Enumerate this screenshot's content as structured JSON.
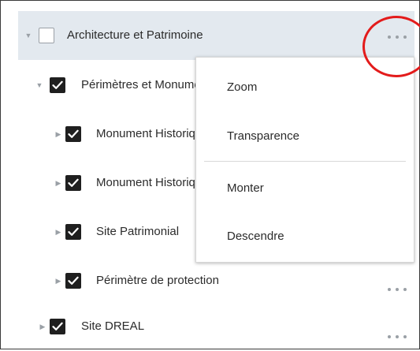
{
  "tree": {
    "root": {
      "label": "Architecture et Patrimoine",
      "checked": false,
      "expanded": true
    },
    "children": [
      {
        "label": "Périmètres et Monuments",
        "checked": true,
        "expanded": true
      },
      {
        "label": "Monument Historique",
        "checked": true,
        "expanded": false
      },
      {
        "label": "Monument Historique",
        "checked": true,
        "expanded": false
      },
      {
        "label": "Site Patrimonial",
        "checked": true,
        "expanded": false
      },
      {
        "label": "Périmètre de protection",
        "checked": true,
        "expanded": false
      },
      {
        "label": "Site DREAL",
        "checked": true,
        "expanded": false
      }
    ]
  },
  "context_menu": {
    "items": [
      "Zoom",
      "Transparence",
      "Monter",
      "Descendre"
    ]
  },
  "colors": {
    "selected_row": "#e3e9ef",
    "highlight": "#e31b1b",
    "checkbox_checked": "#1f1f1f"
  },
  "icons": {
    "expand": "caret-down-icon",
    "collapse": "caret-right-icon",
    "more": "more-horizontal-icon",
    "check": "check-icon"
  }
}
